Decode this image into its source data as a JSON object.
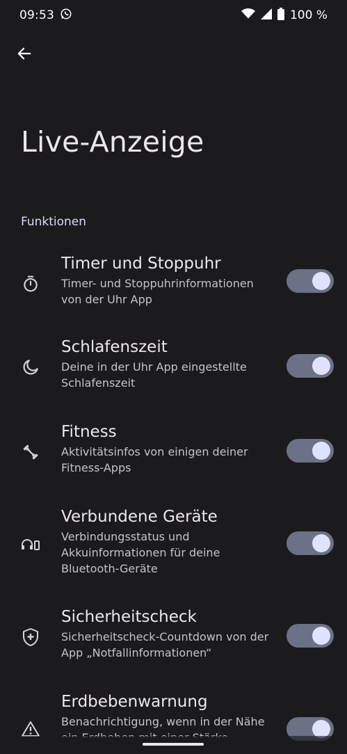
{
  "status_bar": {
    "time": "09:53",
    "notification_icon": "whatsapp-icon",
    "battery_percent": "100 %",
    "icons": [
      "wifi-icon",
      "cellular-signal-icon",
      "battery-icon"
    ]
  },
  "header": {
    "back_icon": "arrow-back-icon",
    "title": "Live-Anzeige"
  },
  "section": {
    "label": "Funktionen"
  },
  "settings": [
    {
      "icon": "timer-icon",
      "title": "Timer und Stoppuhr",
      "summary": "Timer- und Stoppuhrinformationen von der Uhr App",
      "enabled": true
    },
    {
      "icon": "moon-icon",
      "title": "Schlafenszeit",
      "summary": "Deine in der Uhr App eingestellte Schlafenszeit",
      "enabled": true
    },
    {
      "icon": "fitness-icon",
      "title": "Fitness",
      "summary": "Aktivitätsinfos von einigen deiner Fitness-Apps",
      "enabled": true
    },
    {
      "icon": "headphones-device-icon",
      "title": "Verbundene Geräte",
      "summary": "Verbindungsstatus und Akkuinformationen für deine Bluetooth-Geräte",
      "enabled": true
    },
    {
      "icon": "shield-plus-icon",
      "title": "Sicherheitscheck",
      "summary": "Sicherheitscheck-Countdown von der App „Notfallinformationen“",
      "enabled": true
    },
    {
      "icon": "warning-icon",
      "title": "Erdbebenwarnung",
      "summary": "Benachrichtigung, wenn in der Nähe ein Erdbeben mit einer Stärke",
      "enabled": true
    }
  ]
}
